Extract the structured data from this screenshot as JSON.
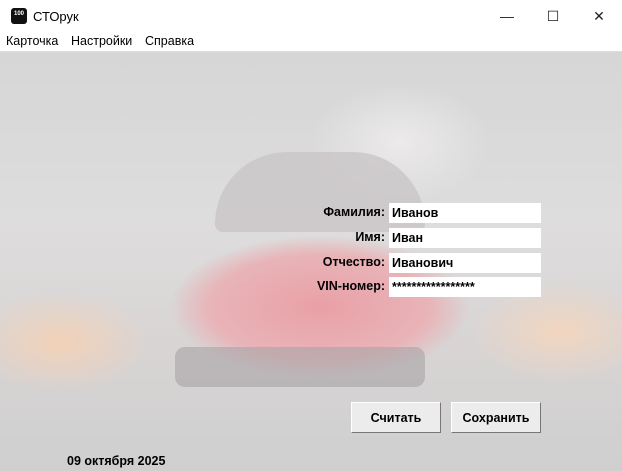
{
  "window": {
    "title": "СТОрук",
    "icon_text": "100",
    "minimize": "—",
    "maximize": "☐",
    "close": "✕"
  },
  "menu": [
    "Карточка",
    "Настройки",
    "Справка"
  ],
  "form": {
    "last_name": {
      "label": "Фамилия:",
      "value": "Иванов"
    },
    "first_name": {
      "label": "Имя:",
      "value": "Иван"
    },
    "patronymic": {
      "label": "Отчество:",
      "value": "Иванович"
    },
    "vin": {
      "label": "VIN-номер:",
      "value": "*****************"
    }
  },
  "buttons": {
    "read": "Считать",
    "save": "Сохранить"
  },
  "date": "09 октября 2025"
}
